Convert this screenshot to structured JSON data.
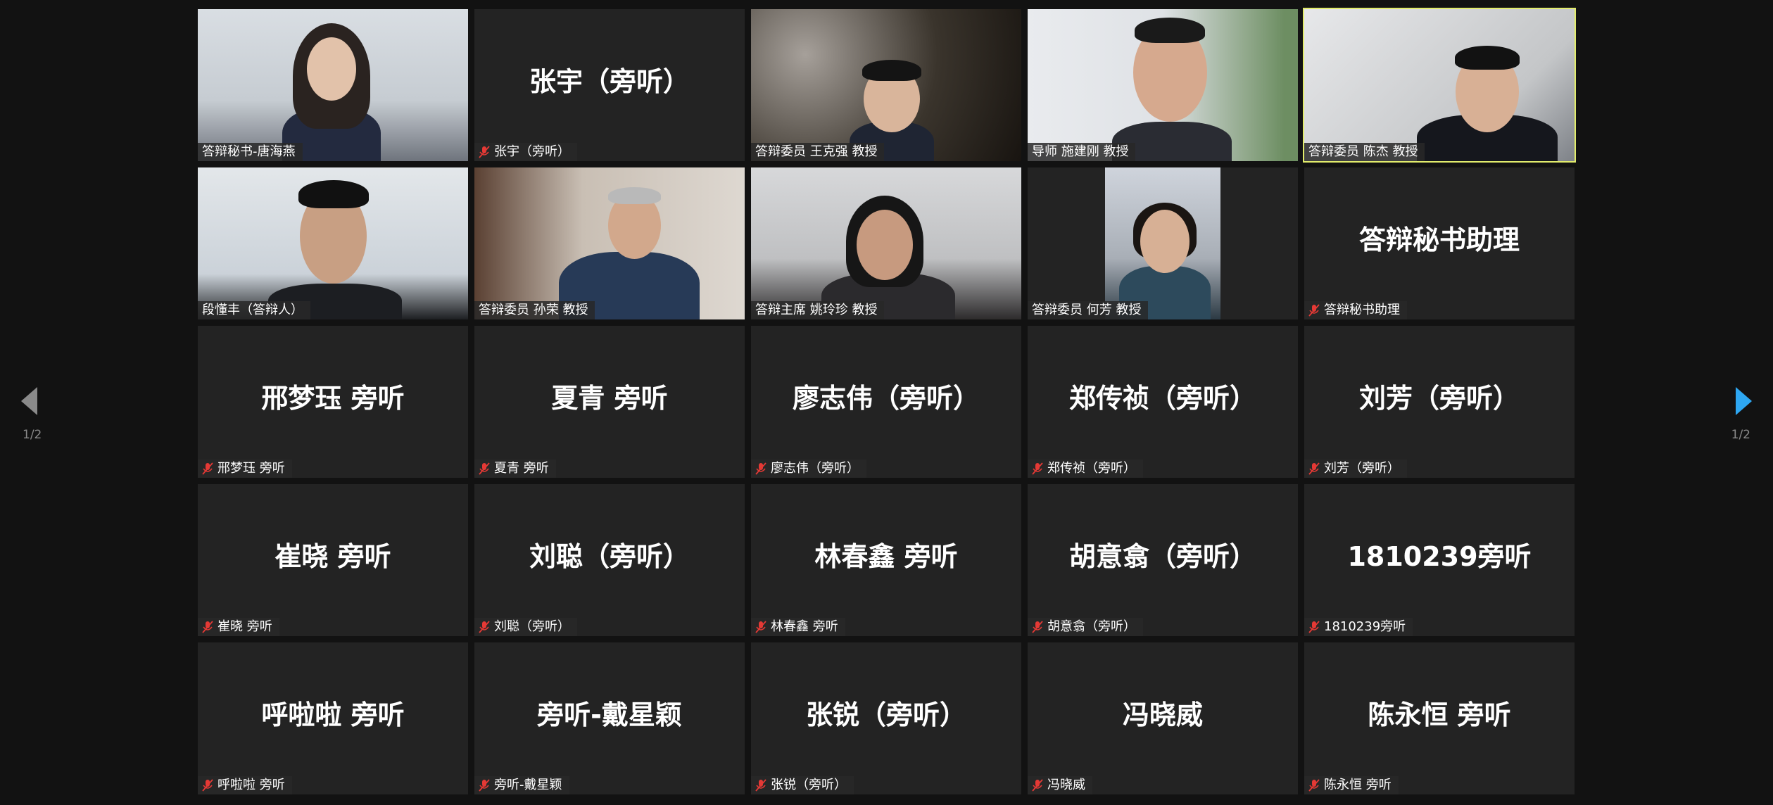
{
  "app": {
    "page_indicator_left": "1/2",
    "page_indicator_right": "1/2"
  },
  "colors": {
    "background": "#121212",
    "tile": "#232323",
    "active_speaker_border": "#e2ec6c",
    "mute_icon": "#e53935",
    "next_arrow": "#2ea7f2",
    "prev_arrow": "#8a8a8a"
  },
  "icons": {
    "mute": "mic-muted-icon",
    "prev": "chevron-left-icon",
    "next": "chevron-right-icon"
  },
  "participants": [
    {
      "tile_name": "",
      "label": "答辩秘书-唐海燕",
      "video": true,
      "muted": false
    },
    {
      "tile_name": "张宇（旁听）",
      "label": "张宇（旁听）",
      "video": false,
      "muted": true
    },
    {
      "tile_name": "",
      "label": "答辩委员 王克强 教授",
      "video": true,
      "muted": false
    },
    {
      "tile_name": "",
      "label": "导师 施建刚 教授",
      "video": true,
      "muted": false
    },
    {
      "tile_name": "",
      "label": "答辩委员 陈杰 教授",
      "video": true,
      "muted": false,
      "active_speaker": true
    },
    {
      "tile_name": "",
      "label": "段懂丰（答辩人）",
      "video": true,
      "muted": false
    },
    {
      "tile_name": "",
      "label": "答辩委员 孙荣 教授",
      "video": true,
      "muted": false
    },
    {
      "tile_name": "",
      "label": "答辩主席 姚玲珍 教授",
      "video": true,
      "muted": false
    },
    {
      "tile_name": "",
      "label": "答辩委员 何芳 教授",
      "video": true,
      "muted": false
    },
    {
      "tile_name": "答辩秘书助理",
      "label": "答辩秘书助理",
      "video": false,
      "muted": true
    },
    {
      "tile_name": "邢梦珏 旁听",
      "label": "邢梦珏 旁听",
      "video": false,
      "muted": true
    },
    {
      "tile_name": "夏青 旁听",
      "label": "夏青 旁听",
      "video": false,
      "muted": true
    },
    {
      "tile_name": "廖志伟（旁听）",
      "label": "廖志伟（旁听）",
      "video": false,
      "muted": true
    },
    {
      "tile_name": "郑传祯（旁听）",
      "label": "郑传祯（旁听）",
      "video": false,
      "muted": true
    },
    {
      "tile_name": "刘芳（旁听）",
      "label": "刘芳（旁听）",
      "video": false,
      "muted": true
    },
    {
      "tile_name": "崔晓 旁听",
      "label": "崔晓 旁听",
      "video": false,
      "muted": true
    },
    {
      "tile_name": "刘聪（旁听）",
      "label": "刘聪（旁听）",
      "video": false,
      "muted": true
    },
    {
      "tile_name": "林春鑫 旁听",
      "label": "林春鑫 旁听",
      "video": false,
      "muted": true
    },
    {
      "tile_name": "胡意翕（旁听）",
      "label": "胡意翕（旁听）",
      "video": false,
      "muted": true
    },
    {
      "tile_name": "1810239旁听",
      "label": "1810239旁听",
      "video": false,
      "muted": true
    },
    {
      "tile_name": "呼啦啦 旁听",
      "label": "呼啦啦 旁听",
      "video": false,
      "muted": true
    },
    {
      "tile_name": "旁听-戴星颖",
      "label": "旁听-戴星颖",
      "video": false,
      "muted": true
    },
    {
      "tile_name": "张锐（旁听）",
      "label": "张锐（旁听）",
      "video": false,
      "muted": true
    },
    {
      "tile_name": "冯晓威",
      "label": "冯晓威",
      "video": false,
      "muted": true
    },
    {
      "tile_name": "陈永恒 旁听",
      "label": "陈永恒 旁听",
      "video": false,
      "muted": true
    }
  ]
}
